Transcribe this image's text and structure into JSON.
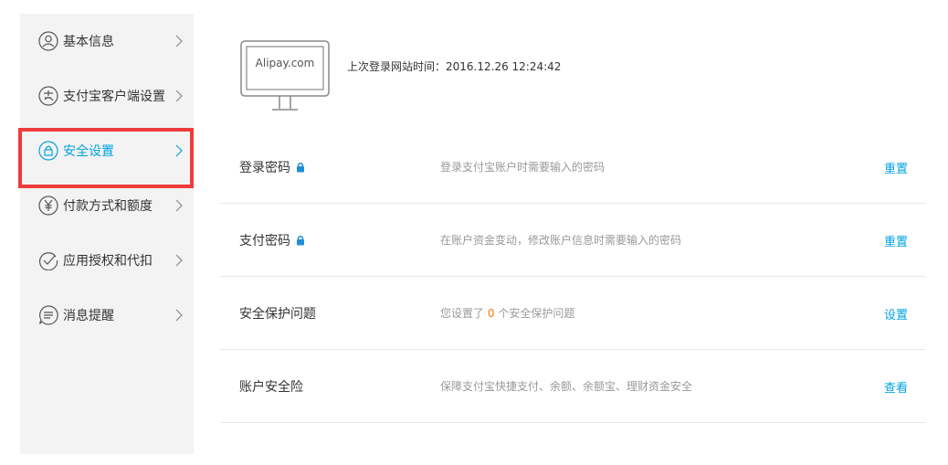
{
  "sidebar": {
    "items": [
      {
        "label": "基本信息",
        "icon": "user-icon"
      },
      {
        "label": "支付宝客户端设置",
        "icon": "alipay-client-icon"
      },
      {
        "label": "安全设置",
        "icon": "lock-icon",
        "active": true
      },
      {
        "label": "付款方式和额度",
        "icon": "yuan-icon"
      },
      {
        "label": "应用授权和代扣",
        "icon": "check-circle-icon"
      },
      {
        "label": "消息提醒",
        "icon": "message-icon"
      }
    ],
    "active_color": "#00a2e0"
  },
  "header": {
    "monitor_text": "Alipay.com",
    "last_login": "上次登录网站时间：2016.12.26 12:24:42"
  },
  "rows": [
    {
      "name": "登录密码",
      "locked": true,
      "desc": "登录支付宝账户时需要输入的密码",
      "action": "重置"
    },
    {
      "name": "支付密码",
      "locked": true,
      "desc": "在账户资金变动，修改账户信息时需要输入的密码",
      "action": "重置"
    },
    {
      "name": "安全保护问题",
      "locked": false,
      "desc_prefix": "您设置了",
      "desc_count": "0",
      "desc_suffix": "个安全保护问题",
      "action": "设置"
    },
    {
      "name": "账户安全险",
      "locked": false,
      "desc": "保障支付宝快捷支付、余额、余额宝、理财资金安全",
      "action": "查看"
    }
  ],
  "colors": {
    "highlight": "#ee3b3b",
    "link": "#00a2e0",
    "count": "#ff7700"
  }
}
